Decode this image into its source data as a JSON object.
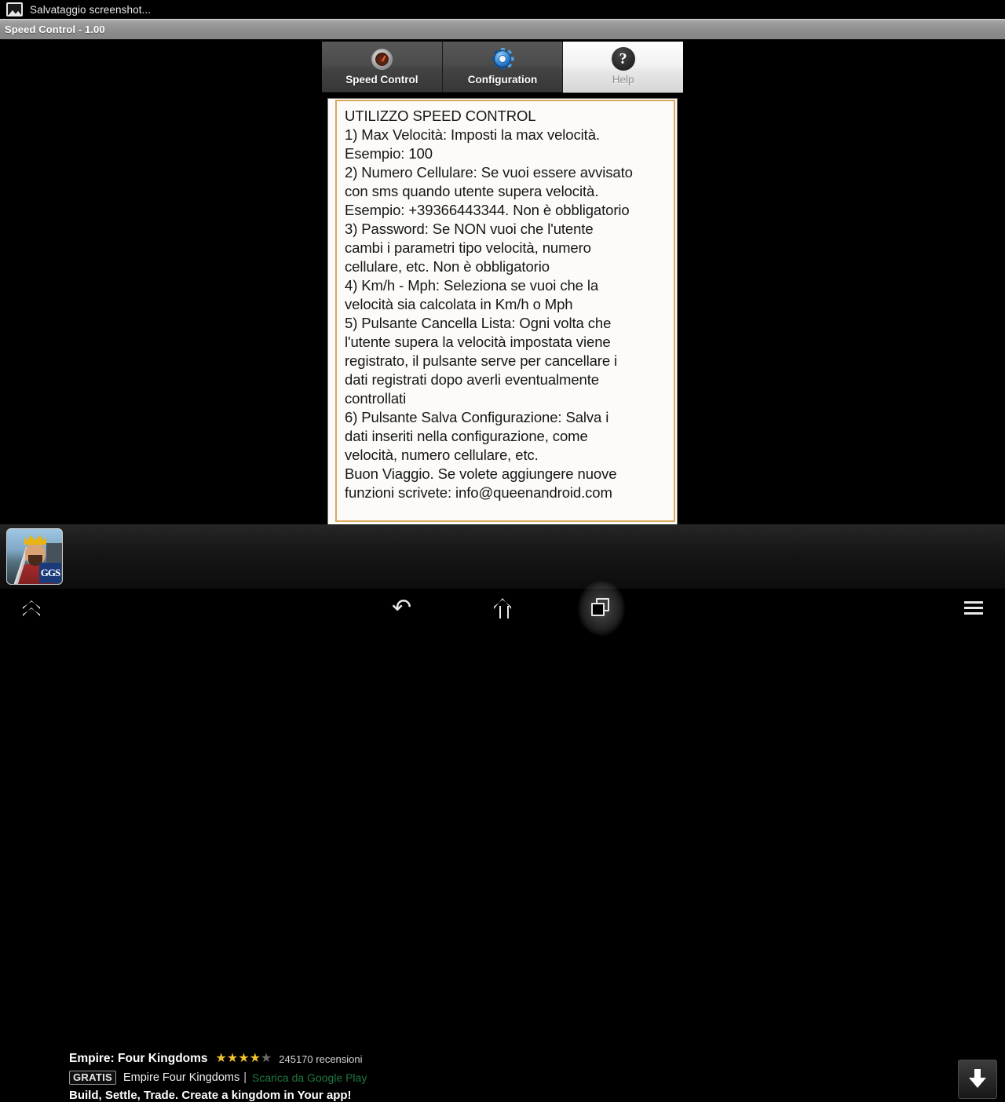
{
  "status_bar": {
    "icon": "screenshot-image-icon",
    "text": "Salvataggio screenshot..."
  },
  "title_bar": {
    "title": "Speed Control - 1.00"
  },
  "tabs": [
    {
      "label": "Speed Control",
      "icon": "speedometer-icon",
      "selected": false
    },
    {
      "label": "Configuration",
      "icon": "gear-icon",
      "selected": false
    },
    {
      "label": "Help",
      "icon": "question-mark-icon",
      "selected": true
    }
  ],
  "help_panel": {
    "border_color": "#d8a85e",
    "background_color": "#fcfbf9",
    "text": "UTILIZZO SPEED CONTROL\n1) Max Velocità: Imposti la max velocità.\nEsempio: 100\n2) Numero Cellulare: Se vuoi essere avvisato\ncon sms quando utente supera velocità.\nEsempio: +39366443344. Non è obbligatorio\n3) Password: Se NON vuoi che l'utente\ncambi i parametri tipo velocità, numero\ncellulare, etc. Non è obbligatorio\n4) Km/h - Mph: Seleziona se vuoi che la\nvelocità sia calcolata in Km/h o Mph\n5) Pulsante Cancella Lista: Ogni volta che\nl'utente supera la velocità impostata viene\nregistrato, il pulsante serve per cancellare i\ndati registrati dopo averli eventualmente\ncontrollati\n6) Pulsante Salva Configurazione: Salva i\ndati inseriti nella configurazione, come\nvelocità, numero cellulare, etc.\nBuon Viaggio. Se volete aggiungere nuove\nfunzioni scrivete: info@queenandroid.com"
  },
  "ad": {
    "app_icon": "empire-four-kingdoms-app-icon",
    "title": "Empire: Four Kingdoms",
    "stars_filled": 4,
    "stars_total": 5,
    "star_on_color": "#f2c230",
    "star_off_color": "#6d6d6d",
    "reviews": "245170 recensioni",
    "badge": "GRATIS",
    "subtitle": "Empire Four Kingdoms",
    "separator": "|",
    "link": "Scarica da Google Play",
    "link_color": "#1f7a3f",
    "description": "Build, Settle, Trade. Create a kingdom in Your app!",
    "download_button_icon": "download-arrow-icon"
  },
  "nav_bar": {
    "buttons": [
      {
        "name": "collapse-icon"
      },
      {
        "name": "back-icon"
      },
      {
        "name": "home-icon"
      },
      {
        "name": "recent-apps-icon"
      },
      {
        "name": "menu-icon"
      }
    ]
  }
}
